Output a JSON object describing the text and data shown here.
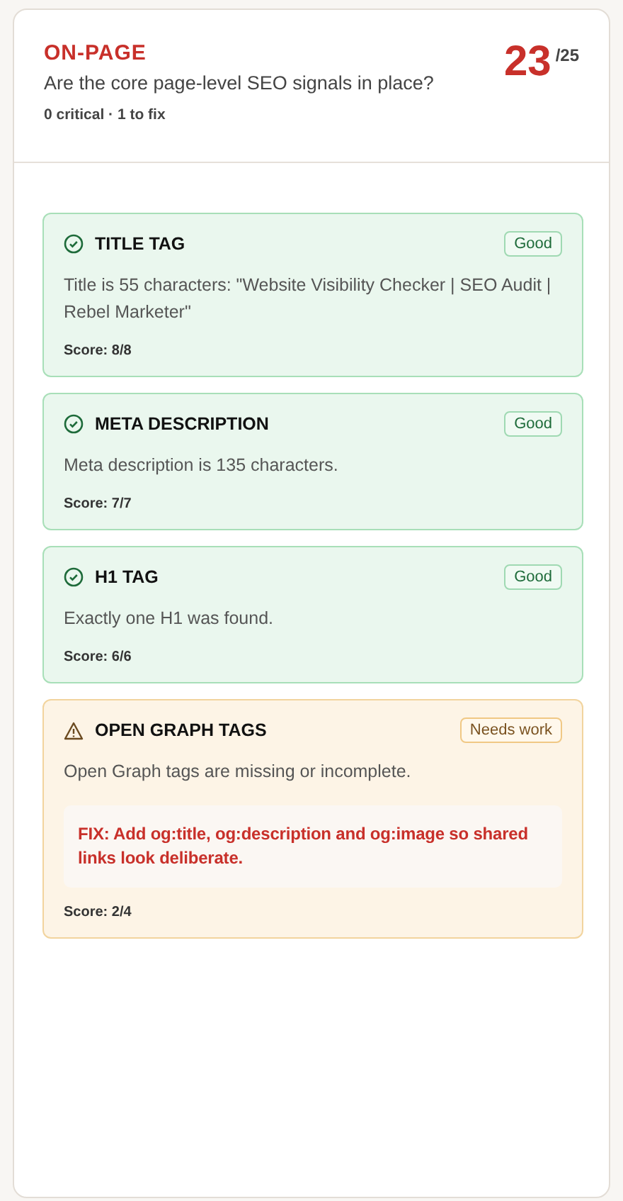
{
  "section": {
    "label": "ON-PAGE",
    "question": "Are the core page-level SEO signals in place?",
    "summary": "0 critical · 1 to fix",
    "score": "23",
    "max": "/25"
  },
  "checks": [
    {
      "title": "TITLE TAG",
      "kind": "good",
      "badge": "Good",
      "detail": "Title is 55 characters: \"Website Visibility Checker | SEO Audit | Rebel Marketer\"",
      "score": "Score: 8/8"
    },
    {
      "title": "META DESCRIPTION",
      "kind": "good",
      "badge": "Good",
      "detail": "Meta description is 135 characters.",
      "score": "Score: 7/7"
    },
    {
      "title": "H1 TAG",
      "kind": "good",
      "badge": "Good",
      "detail": "Exactly one H1 was found.",
      "score": "Score: 6/6"
    },
    {
      "title": "OPEN GRAPH TAGS",
      "kind": "warn",
      "badge": "Needs work",
      "detail": "Open Graph tags are missing or incomplete.",
      "fix": "FIX: Add og:title, og:description and og:image so shared links look deliberate.",
      "score": "Score: 2/4"
    }
  ]
}
